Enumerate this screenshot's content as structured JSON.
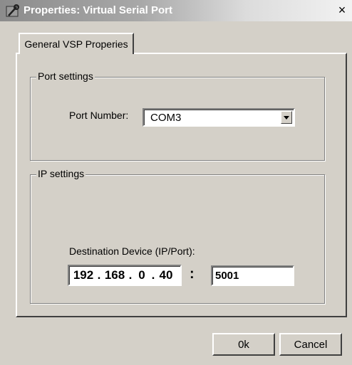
{
  "window": {
    "title": "Properties: Virtual Serial Port",
    "close_glyph": "×",
    "title_icon": "serial-port-wrench-icon"
  },
  "tabs": [
    {
      "label": "General VSP Properies",
      "active": true
    }
  ],
  "port_settings": {
    "group_label": "Port settings",
    "port_number_label": "Port Number:",
    "port_number_value": "COM3"
  },
  "ip_settings": {
    "group_label": "IP settings",
    "destination_label": "Destination Device (IP/Port):",
    "ip_octets": [
      "192",
      "168",
      "0",
      "40"
    ],
    "ip_separator": ".",
    "port_separator": ":",
    "port_value": "5001"
  },
  "buttons": {
    "ok_label": "0k",
    "cancel_label": "Cancel"
  },
  "colors": {
    "dialog_face": "#d4d0c8",
    "titlebar_text": "#ffffff"
  }
}
